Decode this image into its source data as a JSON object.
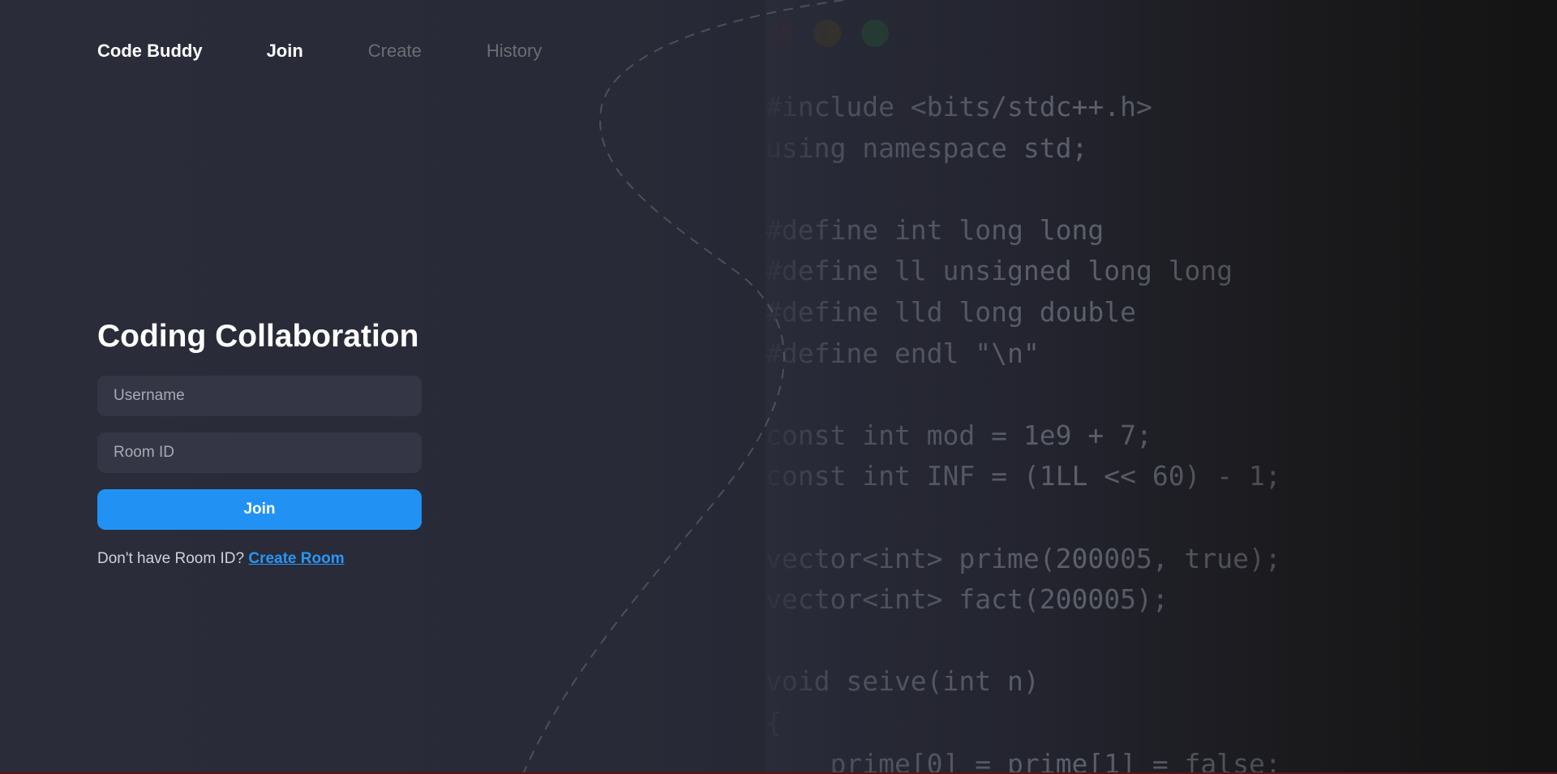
{
  "nav": {
    "brand": "Code Buddy",
    "links": [
      {
        "label": "Join",
        "active": true
      },
      {
        "label": "Create",
        "active": false
      },
      {
        "label": "History",
        "active": false
      }
    ]
  },
  "form": {
    "title": "Coding Collaboration",
    "username_placeholder": "Username",
    "room_id_placeholder": "Room ID",
    "join_label": "Join",
    "helper_text": "Don't have Room ID?",
    "create_room_link": "Create Room"
  },
  "background_code": {
    "window_dots": [
      "red",
      "yellow",
      "green"
    ],
    "lines": [
      "#include <bits/stdc++.h>",
      "using namespace std;",
      "",
      "#define int long long",
      "#define ll unsigned long long",
      "#define lld long double",
      "#define endl \"\\n\"",
      "",
      "const int mod = 1e9 + 7;",
      "const int INF = (1LL << 60) - 1;",
      "",
      "vector<int> prime(200005, true);",
      "vector<int> fact(200005);",
      "",
      "void seive(int n)",
      "{",
      "    prime[0] = prime[1] = false;"
    ]
  },
  "colors": {
    "accent": "#2192f3",
    "link": "#2996f5",
    "input_bg": "#343646",
    "background": "#2a2c3a"
  }
}
